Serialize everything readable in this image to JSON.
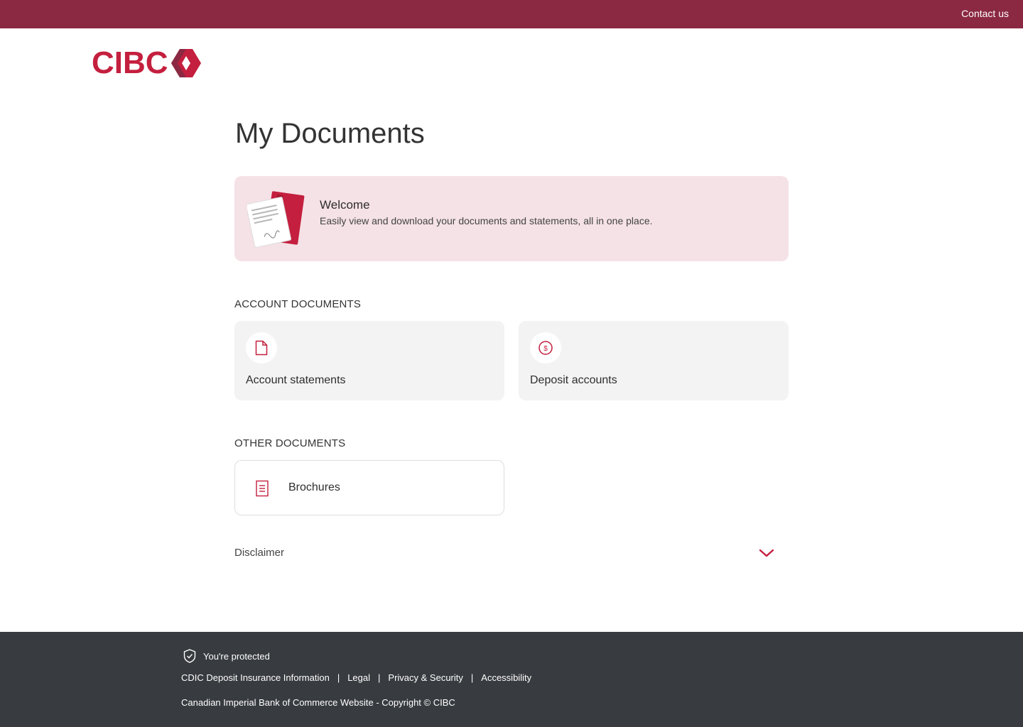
{
  "topbar": {
    "contact_label": "Contact us"
  },
  "brand": {
    "logo_text": "CIBC",
    "primary_color": "#c41f3e",
    "topbar_color": "#8b2942"
  },
  "page": {
    "title": "My Documents"
  },
  "welcome": {
    "title": "Welcome",
    "description": "Easily view and download your documents and statements, all in one place.",
    "illustration": "documents-illustration"
  },
  "account_documents": {
    "heading": "ACCOUNT DOCUMENTS",
    "items": [
      {
        "label": "Account statements",
        "icon": "document-icon"
      },
      {
        "label": "Deposit accounts",
        "icon": "dollar-circle-icon"
      }
    ]
  },
  "other_documents": {
    "heading": "OTHER DOCUMENTS",
    "items": [
      {
        "label": "Brochures",
        "icon": "brochure-icon"
      }
    ]
  },
  "disclaimer": {
    "label": "Disclaimer",
    "icon": "chevron-down-icon"
  },
  "footer": {
    "protected_label": "You're protected",
    "links": [
      "CDIC Deposit Insurance Information",
      "Legal",
      "Privacy & Security",
      "Accessibility"
    ],
    "separator": "|",
    "copyright": "Canadian Imperial Bank of Commerce Website - Copyright © CIBC"
  }
}
